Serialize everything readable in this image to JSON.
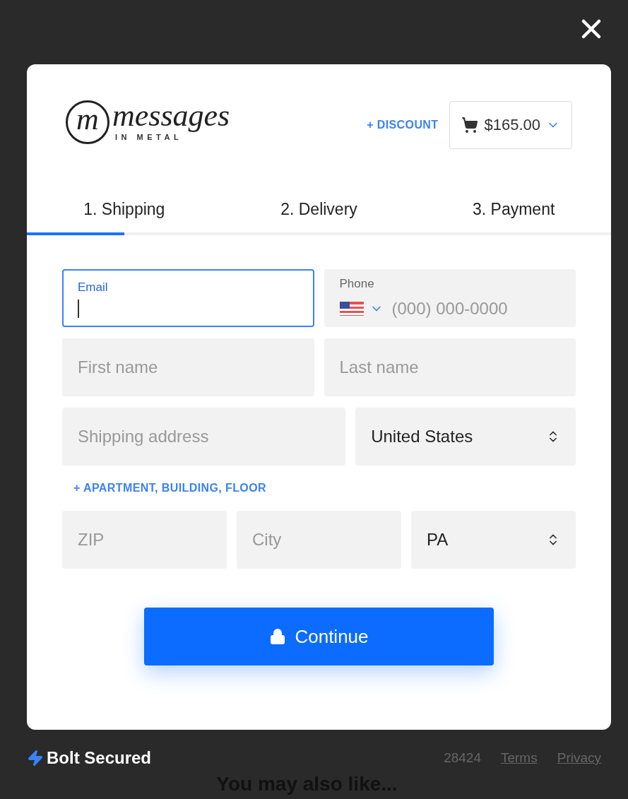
{
  "logo": {
    "monogram": "m",
    "wordmark": "messages",
    "tagline": "IN METAL"
  },
  "discount_link": "+ DISCOUNT",
  "cart": {
    "total": "$165.00"
  },
  "tabs": [
    {
      "label": "1. Shipping",
      "selected": true
    },
    {
      "label": "2. Delivery",
      "selected": false
    },
    {
      "label": "3. Payment",
      "selected": false
    }
  ],
  "form_rows": [
    {
      "kind": "fields",
      "fields": [
        {
          "kind": "text",
          "label": "Email",
          "focused": true
        },
        {
          "kind": "phone",
          "label": "Phone",
          "placeholder": "(000) 000-0000",
          "focused": false
        }
      ]
    },
    {
      "kind": "fields",
      "fields": [
        {
          "kind": "text",
          "placeholder": "First name",
          "focused": false
        },
        {
          "kind": "text",
          "placeholder": "Last name",
          "focused": false
        }
      ]
    },
    {
      "kind": "fields",
      "fields": [
        {
          "kind": "text",
          "placeholder": "Shipping address",
          "focused": false
        },
        {
          "kind": "select",
          "value": "United States",
          "focused": false
        }
      ]
    },
    {
      "kind": "link",
      "text": "+ APARTMENT, BUILDING, FLOOR"
    },
    {
      "kind": "fields",
      "fields": [
        {
          "kind": "text",
          "placeholder": "ZIP",
          "focused": false
        },
        {
          "kind": "text",
          "placeholder": "City",
          "focused": false
        },
        {
          "kind": "select",
          "value": "PA",
          "focused": false
        }
      ]
    }
  ],
  "continue_button": "Continue",
  "footer": {
    "brand": "Bolt Secured",
    "code": "28424",
    "links": [
      "Terms",
      "Privacy"
    ]
  },
  "background_heading": "You may also like..."
}
